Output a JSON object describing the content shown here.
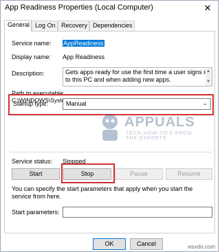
{
  "window": {
    "title": "App Readiness Properties (Local Computer)",
    "close_glyph": "✕"
  },
  "tabs": [
    {
      "label": "General",
      "active": true
    },
    {
      "label": "Log On",
      "active": false
    },
    {
      "label": "Recovery",
      "active": false
    },
    {
      "label": "Dependencies",
      "active": false
    }
  ],
  "general": {
    "service_name_label": "Service name:",
    "service_name_value": "AppReadiness",
    "display_name_label": "Display name:",
    "display_name_value": "App Readiness",
    "description_label": "Description:",
    "description_value": "Gets apps ready for use the first time a user signs in to this PC and when adding new apps.",
    "path_label": "Path to executable:",
    "path_value": "C:\\WINDOWS\\System32\\svchost.exe -k AppReadiness",
    "startup_type_label": "Startup type:",
    "startup_type_value": "Manual",
    "service_status_label": "Service status:",
    "service_status_value": "Stopped",
    "buttons": {
      "start": "Start",
      "stop": "Stop",
      "pause": "Pause",
      "resume": "Resume"
    },
    "hint_text": "You can specify the start parameters that apply when you start the service from here.",
    "start_params_label": "Start parameters:",
    "start_params_value": ""
  },
  "footer": {
    "ok": "OK",
    "cancel": "Cancel"
  },
  "watermark": {
    "brand": "APPUALS",
    "tagline": "TECH HOW-TO'S FROM THE EXPERTS"
  },
  "site_mark": "wsxdn.com",
  "colors": {
    "highlight": "#d32f2f",
    "selection": "#0078d7"
  }
}
